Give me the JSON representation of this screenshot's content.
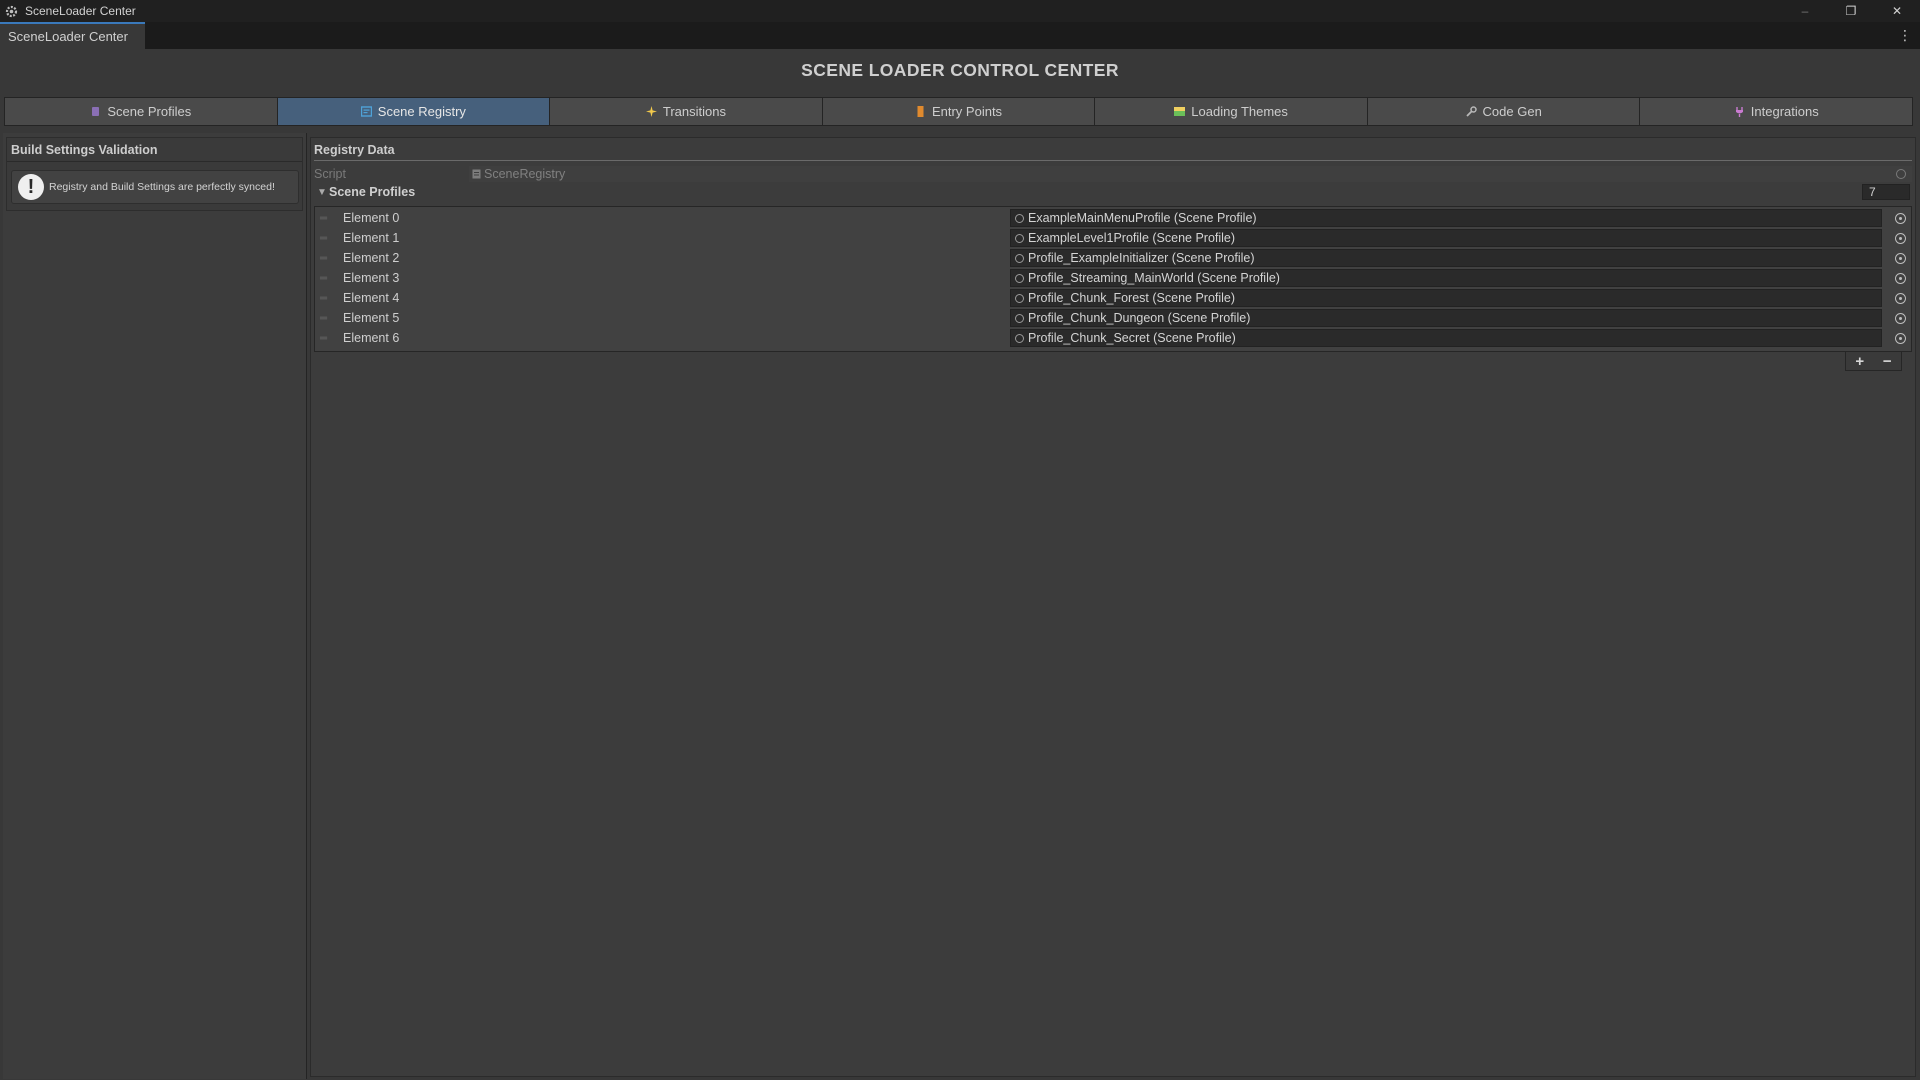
{
  "window": {
    "title": "SceneLoader Center",
    "controls": {
      "minimize": "–",
      "restore": "❐",
      "close": "✕"
    }
  },
  "editor_tab": {
    "label": "SceneLoader Center",
    "menu_glyph": "⋮"
  },
  "header": {
    "title": "SCENE LOADER CONTROL CENTER"
  },
  "toolbar": {
    "tabs": [
      {
        "label": "Scene Profiles",
        "icon": "profile-icon",
        "color": "#8a6fb5",
        "active": false
      },
      {
        "label": "Scene Registry",
        "icon": "registry-icon",
        "color": "#4fa3d9",
        "active": true
      },
      {
        "label": "Transitions",
        "icon": "sparkle-icon",
        "color": "#f2c94c",
        "active": false
      },
      {
        "label": "Entry Points",
        "icon": "door-icon",
        "color": "#e08a2e",
        "active": false
      },
      {
        "label": "Loading Themes",
        "icon": "image-icon",
        "color": "#6bbf59",
        "active": false
      },
      {
        "label": "Code Gen",
        "icon": "wrench-icon",
        "color": "#b8b8b8",
        "active": false
      },
      {
        "label": "Integrations",
        "icon": "plug-icon",
        "color": "#c97bd0",
        "active": false
      }
    ]
  },
  "validation": {
    "title": "Build Settings Validation",
    "message": "Registry and Build Settings are perfectly synced!",
    "icon": "exclamation-icon"
  },
  "registry": {
    "header": "Registry Data",
    "script_label": "Script",
    "script_value": "SceneRegistry",
    "foldout_label": "Scene Profiles",
    "count": "7",
    "elements": [
      {
        "label": "Element 0",
        "value": "ExampleMainMenuProfile (Scene Profile)"
      },
      {
        "label": "Element 1",
        "value": "ExampleLevel1Profile (Scene Profile)"
      },
      {
        "label": "Element 2",
        "value": "Profile_ExampleInitializer (Scene Profile)"
      },
      {
        "label": "Element 3",
        "value": "Profile_Streaming_MainWorld (Scene Profile)"
      },
      {
        "label": "Element 4",
        "value": "Profile_Chunk_Forest (Scene Profile)"
      },
      {
        "label": "Element 5",
        "value": "Profile_Chunk_Dungeon (Scene Profile)"
      },
      {
        "label": "Element 6",
        "value": "Profile_Chunk_Secret (Scene Profile)"
      }
    ],
    "add_label": "+",
    "remove_label": "−"
  }
}
